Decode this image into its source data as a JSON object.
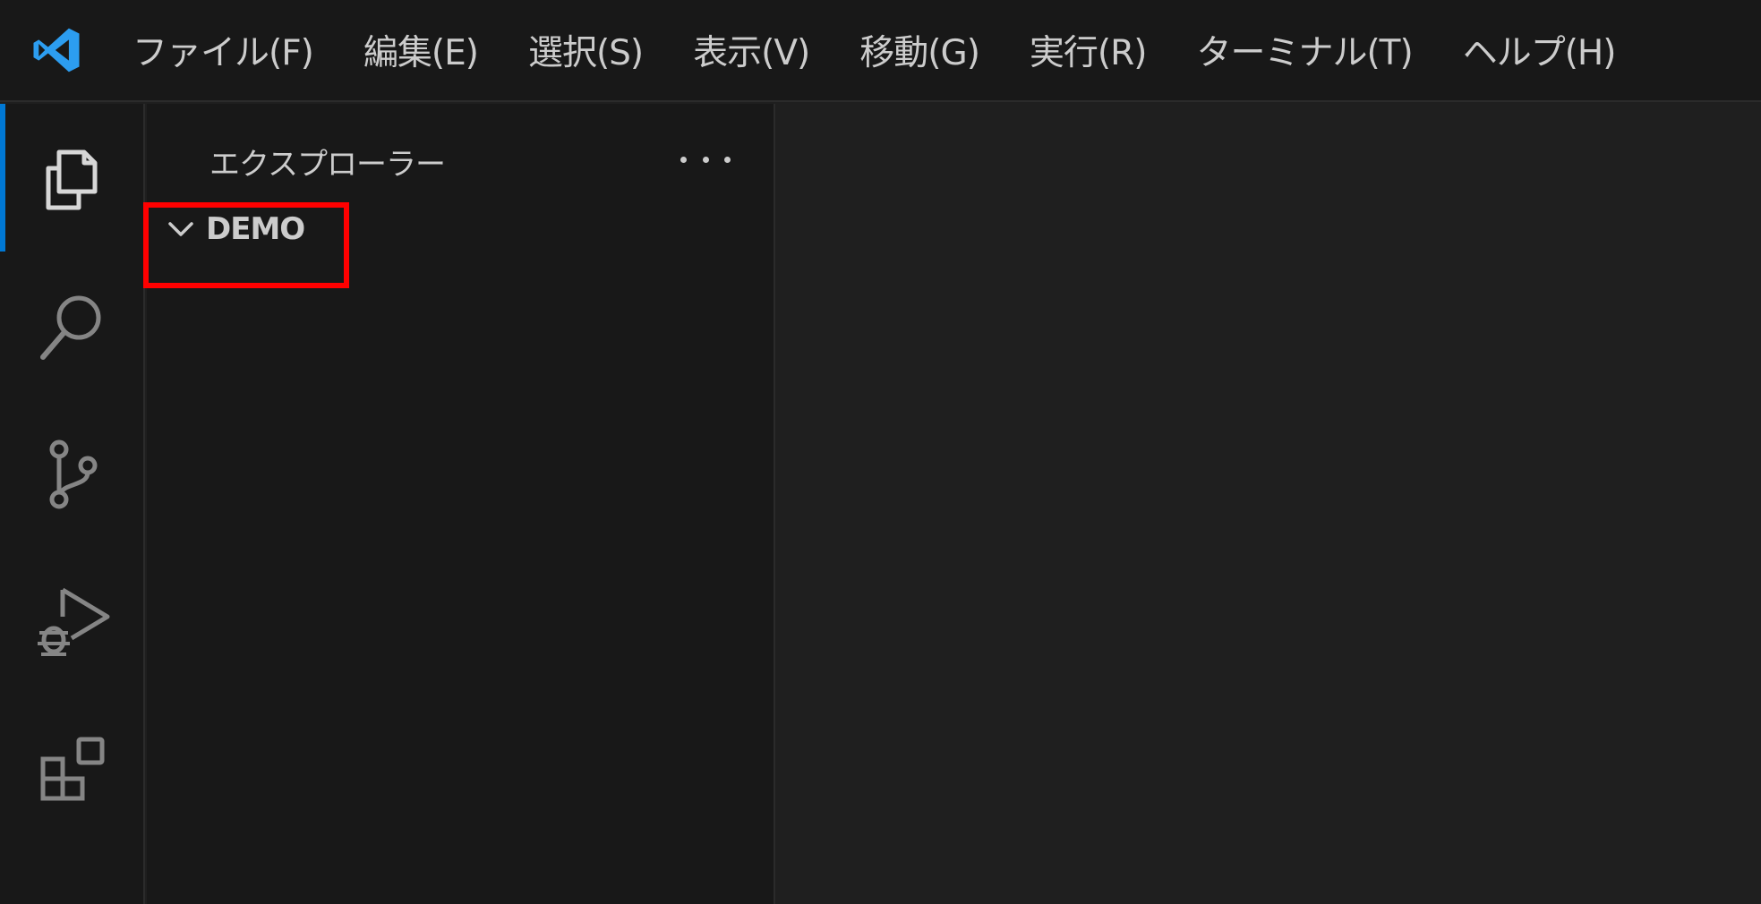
{
  "menu": {
    "items": [
      {
        "label": "ファイル(F)"
      },
      {
        "label": "編集(E)"
      },
      {
        "label": "選択(S)"
      },
      {
        "label": "表示(V)"
      },
      {
        "label": "移動(G)"
      },
      {
        "label": "実行(R)"
      },
      {
        "label": "ターミナル(T)"
      },
      {
        "label": "ヘルプ(H)"
      }
    ]
  },
  "activity_bar": {
    "items": [
      "explorer-icon",
      "search-icon",
      "source-control-icon",
      "run-debug-icon",
      "extensions-icon"
    ],
    "active_index": 0
  },
  "sidebar": {
    "title": "エクスプローラー",
    "folder": "DEMO"
  },
  "colors": {
    "accent": "#0078d4",
    "logo": "#2c9df0",
    "highlight": "#ff0000",
    "background": "#1f1f1f",
    "panel": "#181818"
  }
}
